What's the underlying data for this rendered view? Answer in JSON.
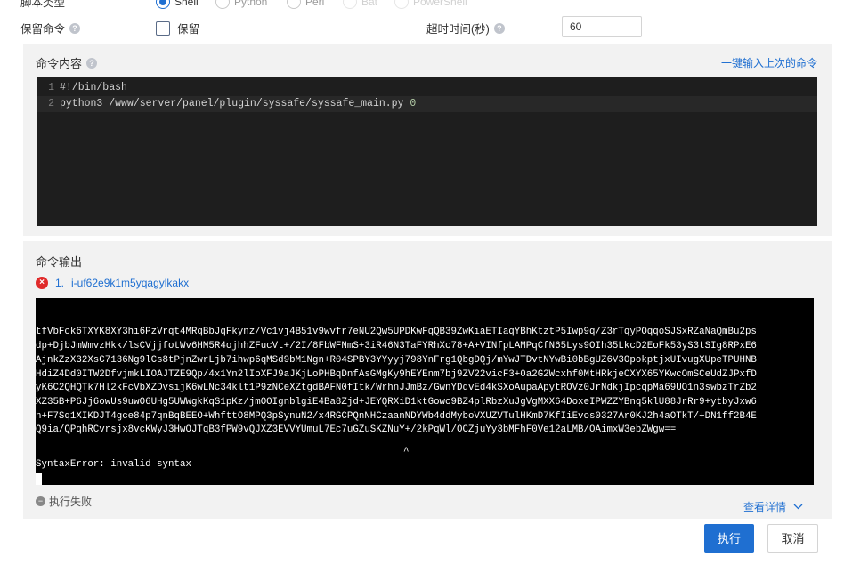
{
  "top_row": {
    "label": "脚本类型",
    "options": [
      {
        "label": "Shell",
        "selected": true
      },
      {
        "label": "Python",
        "selected": false
      },
      {
        "label": "Perl",
        "selected": false
      },
      {
        "label": "Bat",
        "selected": false
      },
      {
        "label": "PowerShell",
        "selected": false
      }
    ]
  },
  "keep_command": {
    "label": "保留命令",
    "checkbox_label": "保留",
    "checked": false
  },
  "timeout": {
    "label": "超时时间(秒)",
    "value": "60"
  },
  "command_panel": {
    "title": "命令内容",
    "reuse_link": "一键输入上次的命令",
    "lines": [
      {
        "no": "1",
        "text": "#!/bin/bash",
        "arg": ""
      },
      {
        "no": "2",
        "text": "python3 /www/server/panel/plugin/syssafe/syssafe_main.py ",
        "arg": "0"
      }
    ]
  },
  "output_panel": {
    "title": "命令输出",
    "instance_index": "1.",
    "instance_id": "i-uf62e9k1m5yqagylkakx",
    "terminal_lines": [
      "tfVbFck6TXYK8XY3hi6PzVrqt4MRqBbJqFkynz/Vc1vj4B51v9wvfr7eNU2Qw5UPDKwFqQB39ZwKiaETIaqYBhKtztP5Iwp9q/Z3rTqyPOqqoSJSxRZaNaQmBu2ps",
      "dp+DjbJmWmvzHkk/lsCVjjfotWv6HM5R4ojhhZFucVt+/2I/8FbWFNmS+3iR46N3TaFYRhXc78+A+VINfpLAMPqCfN65Lys9OIh35LkcD2EoFk53yS3tSIg8RPxE6",
      "AjnkZzX32XsC7136Ng9lCs8tPjnZwrLjb7ihwp6qMSd9bM1Ngn+R04SPBY3YYyyj798YnFrg1QbgDQj/mYwJTDvtNYwBi0bBgUZ6V3OpokptjxUIvugXUpeTPUHNB",
      "HdiZ4Dd0ITW2DfvjmkLIOAJTZE9Qp/4x1Yn2lIoXFJ9aJKjLoPHBqDnfAsGMgKy9hEYEnm7bj9ZV22vicF3+0a2G2Wcxhf0MtHRkjeCXYX65YKwcOmSCeUdZJPxfD",
      "yK6C2QHQTk7Hl2kFcVbXZDvsijK6wLNc34klt1P9zNCeXZtgdBAFN0fItk/WrhnJJmBz/GwnYDdvEd4kSXoAupaApytROVz0JrNdkjIpcqpMa69UO1n3swbzTrZb2",
      "XZ35B+P6Jj6owUs9uwO6UHg5UWWgkKqS1pKz/jmOOIgnblgiE4Ba8Zjd+JEYQRXiD1ktGowc9BZ4plRbzXuJgVgMXX64DoxeIPWZZYBnq5klU88JrRr9+ytbyJxw6",
      "n+F7Sq1XIKDJT4gce84p7qnBqBEEO+WhfttO8MPQ3pSynuN2/x4RGCPQnNHCzaanNDYWb4ddMyboVXUZVTulHKmD7KfIiEvos0327Ar0KJ2h4aOTkT/+DN1ff2B4E",
      "Q9ia/QPqhRCvrsjx8vcKWyJ3HwOJTqB3fPW9vQJXZ3EVVYUmuL7Ec7uGZuSKZNuY+/2kPqWl/OCZjuYy3bMFhF0Ve12aLMB/OAimxW3ebZWgw=="
    ],
    "caret": "^",
    "error_line": "SyntaxError: invalid syntax",
    "status": "执行失败",
    "details_link": "查看详情"
  },
  "footer": {
    "run_label": "执行",
    "cancel_label": "取消"
  },
  "colors": {
    "accent": "#1f6fd1",
    "error": "#e02a2a",
    "terminal_bg": "#000000"
  }
}
